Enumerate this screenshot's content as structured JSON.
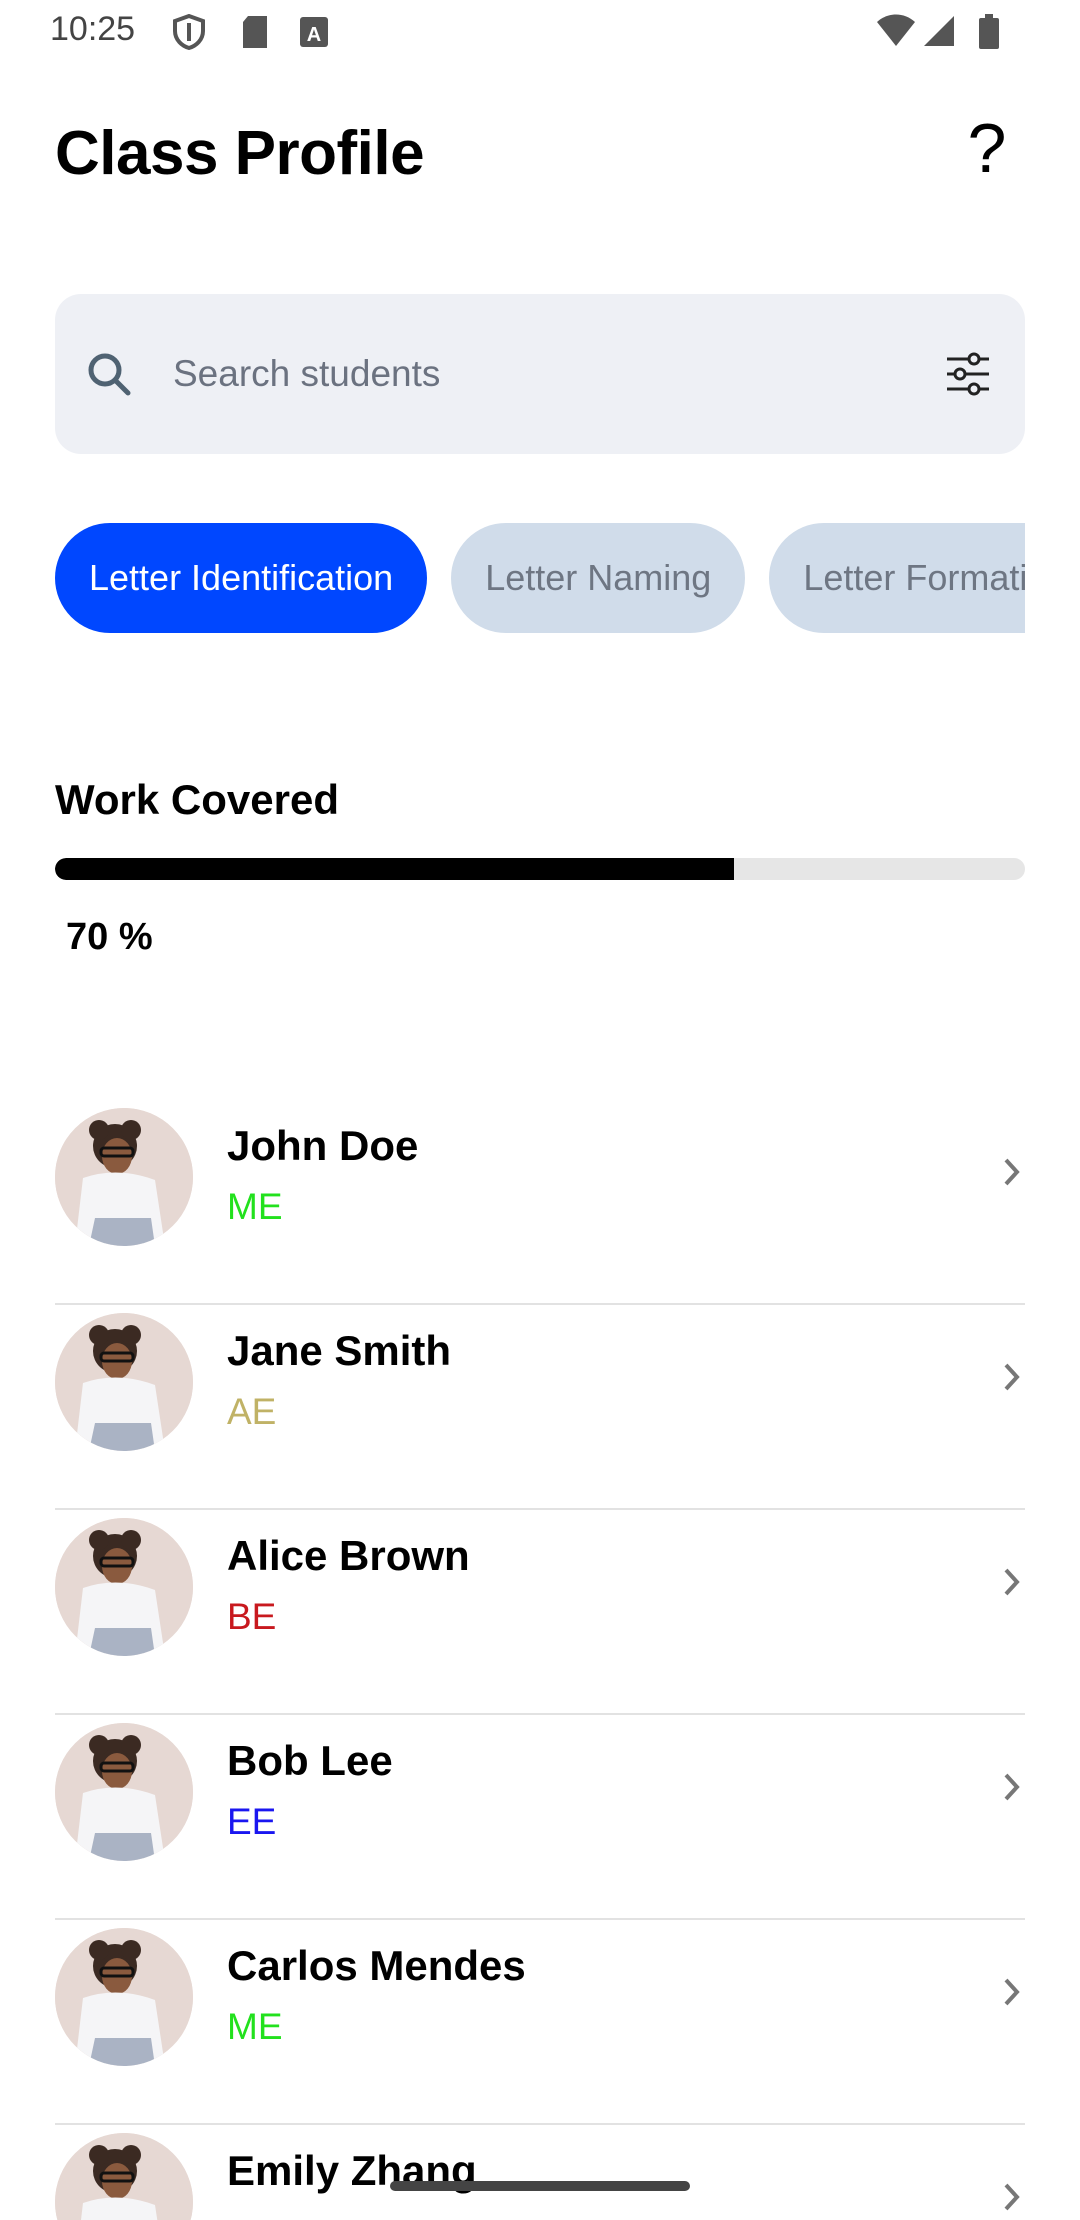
{
  "status_bar": {
    "time": "10:25",
    "left_icons": [
      "shield-icon",
      "sd-card-icon",
      "font-icon"
    ],
    "right_icons": [
      "wifi-icon",
      "signal-icon",
      "battery-icon"
    ]
  },
  "header": {
    "title": "Class Profile",
    "help_label": "?"
  },
  "search": {
    "placeholder": "Search students",
    "value": "",
    "icons": [
      "search-icon",
      "filter-icon"
    ]
  },
  "chips": [
    {
      "label": "Letter Identification",
      "active": true
    },
    {
      "label": "Letter Naming",
      "active": false
    },
    {
      "label": "Letter Formation",
      "active": false
    }
  ],
  "progress": {
    "title": "Work Covered",
    "value": 70,
    "label": "70 %"
  },
  "students": [
    {
      "name": "John Doe",
      "grade": "ME",
      "grade_color": "#22e11d"
    },
    {
      "name": "Jane Smith",
      "grade": "AE",
      "grade_color": "#c0b266"
    },
    {
      "name": "Alice Brown",
      "grade": "BE",
      "grade_color": "#c8191e"
    },
    {
      "name": "Bob Lee",
      "grade": "EE",
      "grade_color": "#1a16f0"
    },
    {
      "name": "Carlos Mendes",
      "grade": "ME",
      "grade_color": "#22e11d"
    },
    {
      "name": "Emily Zhang",
      "grade": "",
      "grade_color": "#22e11d"
    }
  ],
  "colors": {
    "accent": "#0047ff",
    "chip_inactive_bg": "#d0dcea",
    "search_bg": "#eef0f5",
    "progress_fill": "#000000",
    "progress_track": "#e6e6e6"
  }
}
